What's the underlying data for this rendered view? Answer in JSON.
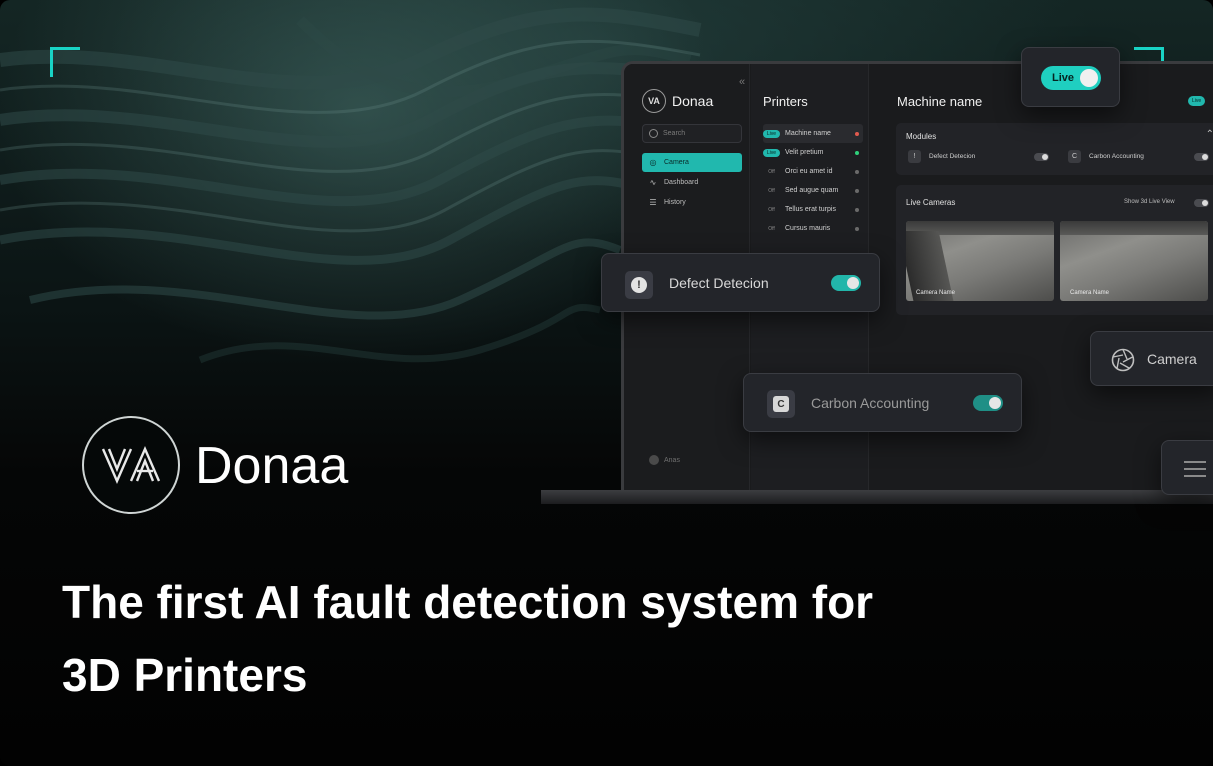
{
  "brand": {
    "name": "Donaa",
    "logo_text": "VA"
  },
  "headline": {
    "line1": "The first AI fault detection system for",
    "line2": "3D Printers"
  },
  "sidebar": {
    "collapse_icon": "double-chevron-left-icon",
    "search_placeholder": "Search",
    "items": [
      {
        "label": "Camera",
        "icon": "aperture-icon",
        "active": true
      },
      {
        "label": "Dashboard",
        "icon": "pulse-icon",
        "active": false
      },
      {
        "label": "History",
        "icon": "list-icon",
        "active": false
      }
    ],
    "user": "Anas"
  },
  "printers": {
    "title": "Printers",
    "items": [
      {
        "status": "Live",
        "name": "Machine name",
        "dot": "#e05a4e",
        "selected": true
      },
      {
        "status": "Live",
        "name": "Velit pretium",
        "dot": "#2fd07a",
        "selected": false
      },
      {
        "status": "Off",
        "name": "Orci eu amet id",
        "dot": "#6a6a6a",
        "selected": false
      },
      {
        "status": "Off",
        "name": "Sed augue quam",
        "dot": "#6a6a6a",
        "selected": false
      },
      {
        "status": "Off",
        "name": "Tellus erat turpis",
        "dot": "#6a6a6a",
        "selected": false
      },
      {
        "status": "Off",
        "name": "Cursus mauris",
        "dot": "#6a6a6a",
        "selected": false
      }
    ]
  },
  "main": {
    "title": "Machine name",
    "live_tag": "Live",
    "modules": {
      "title": "Modules",
      "items": [
        {
          "label": "Defect Detecion",
          "icon_text": "!"
        },
        {
          "label": "Carbon Accounting",
          "icon_text": "C"
        }
      ]
    },
    "live_cameras": {
      "title": "Live Cameras",
      "toggle_label": "Show 3d Live View",
      "feeds": [
        {
          "name": "Camera Name"
        },
        {
          "name": "Camera Name"
        }
      ]
    }
  },
  "floating": {
    "live_toggle_label": "Live",
    "defect_label": "Defect Detecion",
    "defect_icon_text": "!",
    "carbon_label": "Carbon Accounting",
    "carbon_icon_text": "C",
    "camera_label": "Camera"
  },
  "colors": {
    "accent": "#1fcfc0",
    "background": "#000000",
    "panel": "#23252a"
  }
}
